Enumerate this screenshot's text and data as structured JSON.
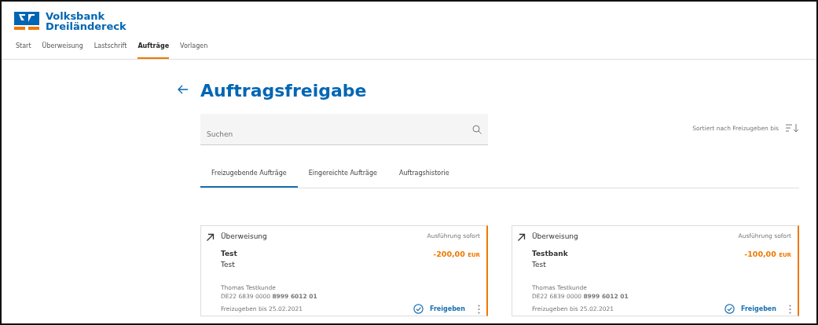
{
  "brand": {
    "line_1": "Volksbank",
    "line_2": "Dreiländereck"
  },
  "nav": [
    {
      "label": "Start",
      "selected": false
    },
    {
      "label": "Überweisung",
      "selected": false
    },
    {
      "label": "Lastschrift",
      "selected": false
    },
    {
      "label": "Aufträge",
      "selected": true
    },
    {
      "label": "Vorlagen",
      "selected": false
    }
  ],
  "page_title": "Auftragsfreigabe",
  "search": {
    "placeholder": "Suchen"
  },
  "sort_label": "Sortiert nach Freizugeben bis",
  "tabs": [
    {
      "label": "Freizugebende Aufträge",
      "selected": true
    },
    {
      "label": "Eingereichte Aufträge",
      "selected": false
    },
    {
      "label": "Auftragshistorie",
      "selected": false
    }
  ],
  "orders": [
    {
      "type": "Überweisung",
      "execution": "Ausführung sofort",
      "recipient": "Test",
      "purpose": "Test",
      "amount": "-200,00",
      "currency": "EUR",
      "account_holder": "Thomas Testkunde",
      "iban": "DE22 6839 0000 **8999 6012 01**",
      "deadline": "Freizugeben bis 25.02.2021",
      "action": "Freigeben"
    },
    {
      "type": "Überweisung",
      "execution": "Ausführung sofort",
      "recipient": "Testbank",
      "purpose": "Test",
      "amount": "-100,00",
      "currency": "EUR",
      "account_holder": "Thomas Testkunde",
      "iban": "DE22 6839 0000 **8999 6012 01**",
      "deadline": "Freizugeben bis 25.02.2021",
      "action": "Freigeben"
    }
  ]
}
